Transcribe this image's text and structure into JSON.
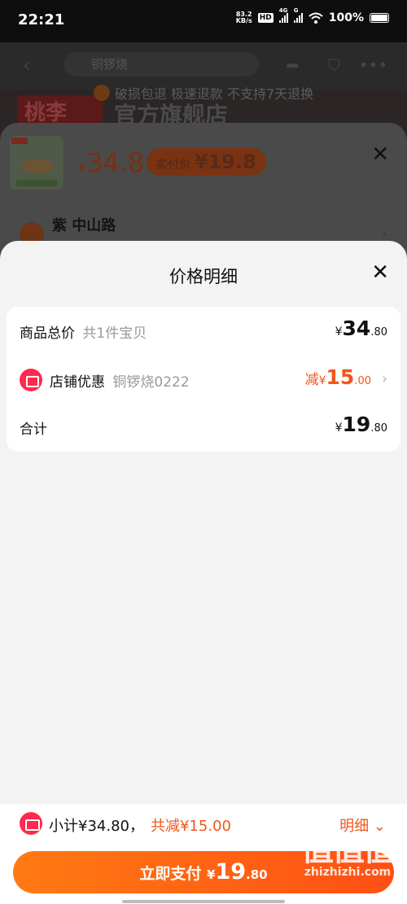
{
  "status": {
    "time": "22:21",
    "net_speed_top": "83.2",
    "net_speed_unit": "KB/s",
    "hd": "HD",
    "signal1": "4G",
    "signal2": "G",
    "battery": "100%"
  },
  "background": {
    "notice": "破损包退 极速退款 不支持7天退换",
    "store_name": "官方旗舰店",
    "store_logo_text": "桃李",
    "search_placeholder": "铜锣烧"
  },
  "product_sheet": {
    "yen": "¥",
    "price": "34.8",
    "real_pay_label": "实付价",
    "real_pay_value": "¥19.8",
    "address": "紫 中山路"
  },
  "price_detail": {
    "title": "价格明细",
    "rows": [
      {
        "label": "商品总价",
        "sub": "共1件宝贝",
        "yen": "¥",
        "int": "34",
        "dec": ".80"
      },
      {
        "label": "店铺优惠",
        "sub": "铜锣烧0222",
        "prefix": "减",
        "yen": "¥",
        "int": "15",
        "dec": ".00"
      },
      {
        "label": "合计",
        "yen": "¥",
        "int": "19",
        "dec": ".80"
      }
    ]
  },
  "bottom_bar": {
    "subtotal": "小计¥34.80，",
    "discount": "共减¥15.00",
    "detail_label": "明细",
    "pay_label": "立即支付",
    "pay_yen": "¥",
    "pay_int": "19",
    "pay_dec": ".80"
  },
  "watermark": {
    "logo": "值值值",
    "site": "zhizhizhi.com"
  },
  "colors": {
    "accent": "#f0561b",
    "brand_red": "#ff2a4d",
    "pay_gradient_start": "#ff7a12",
    "pay_gradient_end": "#ff4f15"
  }
}
